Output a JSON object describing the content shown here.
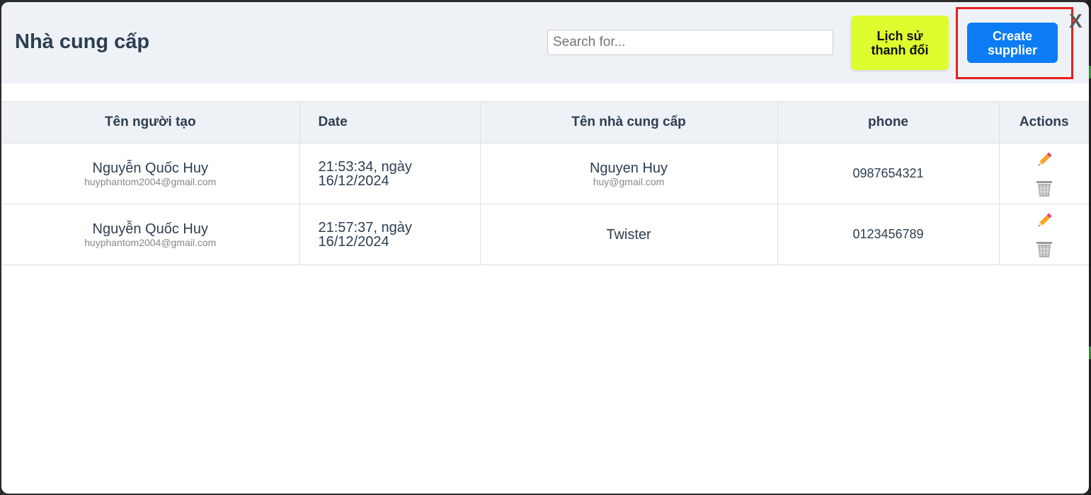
{
  "header": {
    "title": "Nhà cung cấp",
    "search_placeholder": "Search for...",
    "history_button_label": "Lịch sử thanh đổi",
    "create_button_label": "Create supplier",
    "close_label": "X"
  },
  "table": {
    "columns": [
      "Tên người tạo",
      "Date",
      "Tên nhà cung cấp",
      "phone",
      "Actions"
    ],
    "rows": [
      {
        "creator_name": "Nguyễn Quốc Huy",
        "creator_email": "huyphantom2004@gmail.com",
        "date": "21:53:34, ngày 16/12/2024",
        "supplier_name": "Nguyen Huy",
        "supplier_email": "huy@gmail.com",
        "phone": "0987654321"
      },
      {
        "creator_name": "Nguyễn Quốc Huy",
        "creator_email": "huyphantom2004@gmail.com",
        "date": "21:57:37, ngày 16/12/2024",
        "supplier_name": "Twister",
        "supplier_email": "",
        "phone": "0123456789"
      }
    ]
  },
  "icons": {
    "edit": "pencil-icon",
    "delete": "trash-icon"
  },
  "colors": {
    "header_bg": "#eef2f7",
    "history_button_bg": "#dffc2f",
    "create_button_bg": "#0c7cf5",
    "highlight_border": "#e3211b",
    "title_text": "#2d3e50"
  }
}
